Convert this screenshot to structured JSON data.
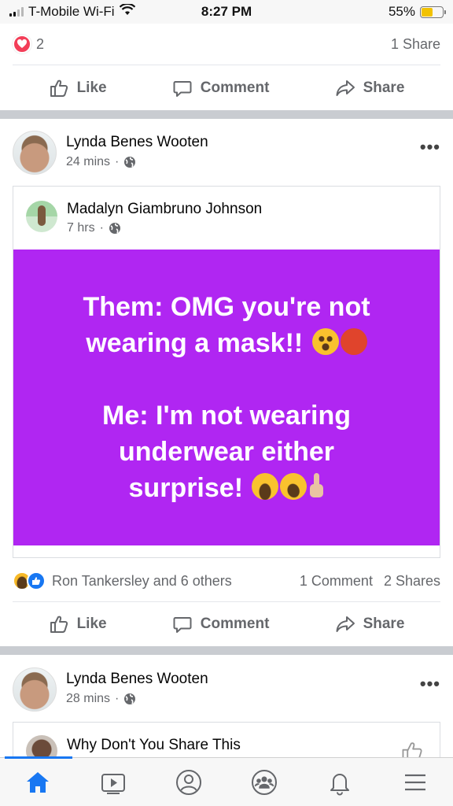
{
  "status_bar": {
    "carrier": "T-Mobile Wi-Fi",
    "time": "8:27 PM",
    "battery": "55%",
    "battery_level": 0.55
  },
  "prev_post": {
    "reactions_count": "2",
    "shares": "1 Share"
  },
  "actions": {
    "like": "Like",
    "comment": "Comment",
    "share": "Share"
  },
  "post1": {
    "author": "Lynda Benes Wooten",
    "time": "24 mins",
    "shared": {
      "author": "Madalyn Giambruno Johnson",
      "time": "7 hrs",
      "text_lines": [
        "Them: OMG you're not",
        "wearing a mask!!",
        "Me: I'm not wearing",
        "underwear either",
        "surprise!"
      ],
      "background_color": "#b026f2"
    },
    "reactions_text": "Ron Tankersley and 6 others",
    "comments": "1 Comment",
    "shares": "2 Shares"
  },
  "post2": {
    "author": "Lynda Benes Wooten",
    "time": "28 mins",
    "shared_title": "Why Don't You Share This"
  },
  "tabs": [
    {
      "name": "home-icon",
      "active": true
    },
    {
      "name": "watch-icon",
      "active": false
    },
    {
      "name": "profile-icon",
      "active": false
    },
    {
      "name": "groups-icon",
      "active": false
    },
    {
      "name": "notifications-icon",
      "active": false
    },
    {
      "name": "menu-icon",
      "active": false
    }
  ],
  "colors": {
    "accent": "#1877f2",
    "text_secondary": "#65676b",
    "heart": "#f33e58"
  }
}
